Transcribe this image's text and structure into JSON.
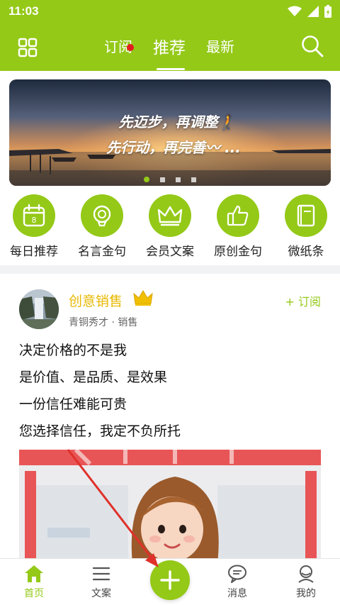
{
  "status_bar": {
    "time": "11:03"
  },
  "nav": {
    "tabs": [
      {
        "label": "订阅",
        "has_dot": true
      },
      {
        "label": "推荐",
        "active": true
      },
      {
        "label": "最新"
      }
    ]
  },
  "banner": {
    "line1": "先迈步，再调整🚶",
    "line2": "先行动，再完善〰 ...",
    "dots": 4,
    "active_dot": 0
  },
  "categories": [
    {
      "label": "每日推荐",
      "icon": "calendar-icon",
      "calendar_day": "8"
    },
    {
      "label": "名言金句",
      "icon": "lightbulb-icon"
    },
    {
      "label": "会员文案",
      "icon": "crown-icon"
    },
    {
      "label": "原创金句",
      "icon": "thumbs-up-icon"
    },
    {
      "label": "微纸条",
      "icon": "book-icon"
    }
  ],
  "post": {
    "author": "创意销售",
    "author_meta": "青铜秀才 · 销售",
    "follow_label": "+ 订阅",
    "lines": [
      "决定价格的不是我",
      "是价值、是品质、是效果",
      "一份信任难能可贵",
      "您选择信任，我定不负所托"
    ]
  },
  "bottom_nav": {
    "home": "首页",
    "copy": "文案",
    "messages": "消息",
    "mine": "我的"
  },
  "colors": {
    "accent": "#94c918",
    "author": "#e8b800",
    "notification_dot": "#e31d1d",
    "annotation_arrow": "#e0302a"
  }
}
